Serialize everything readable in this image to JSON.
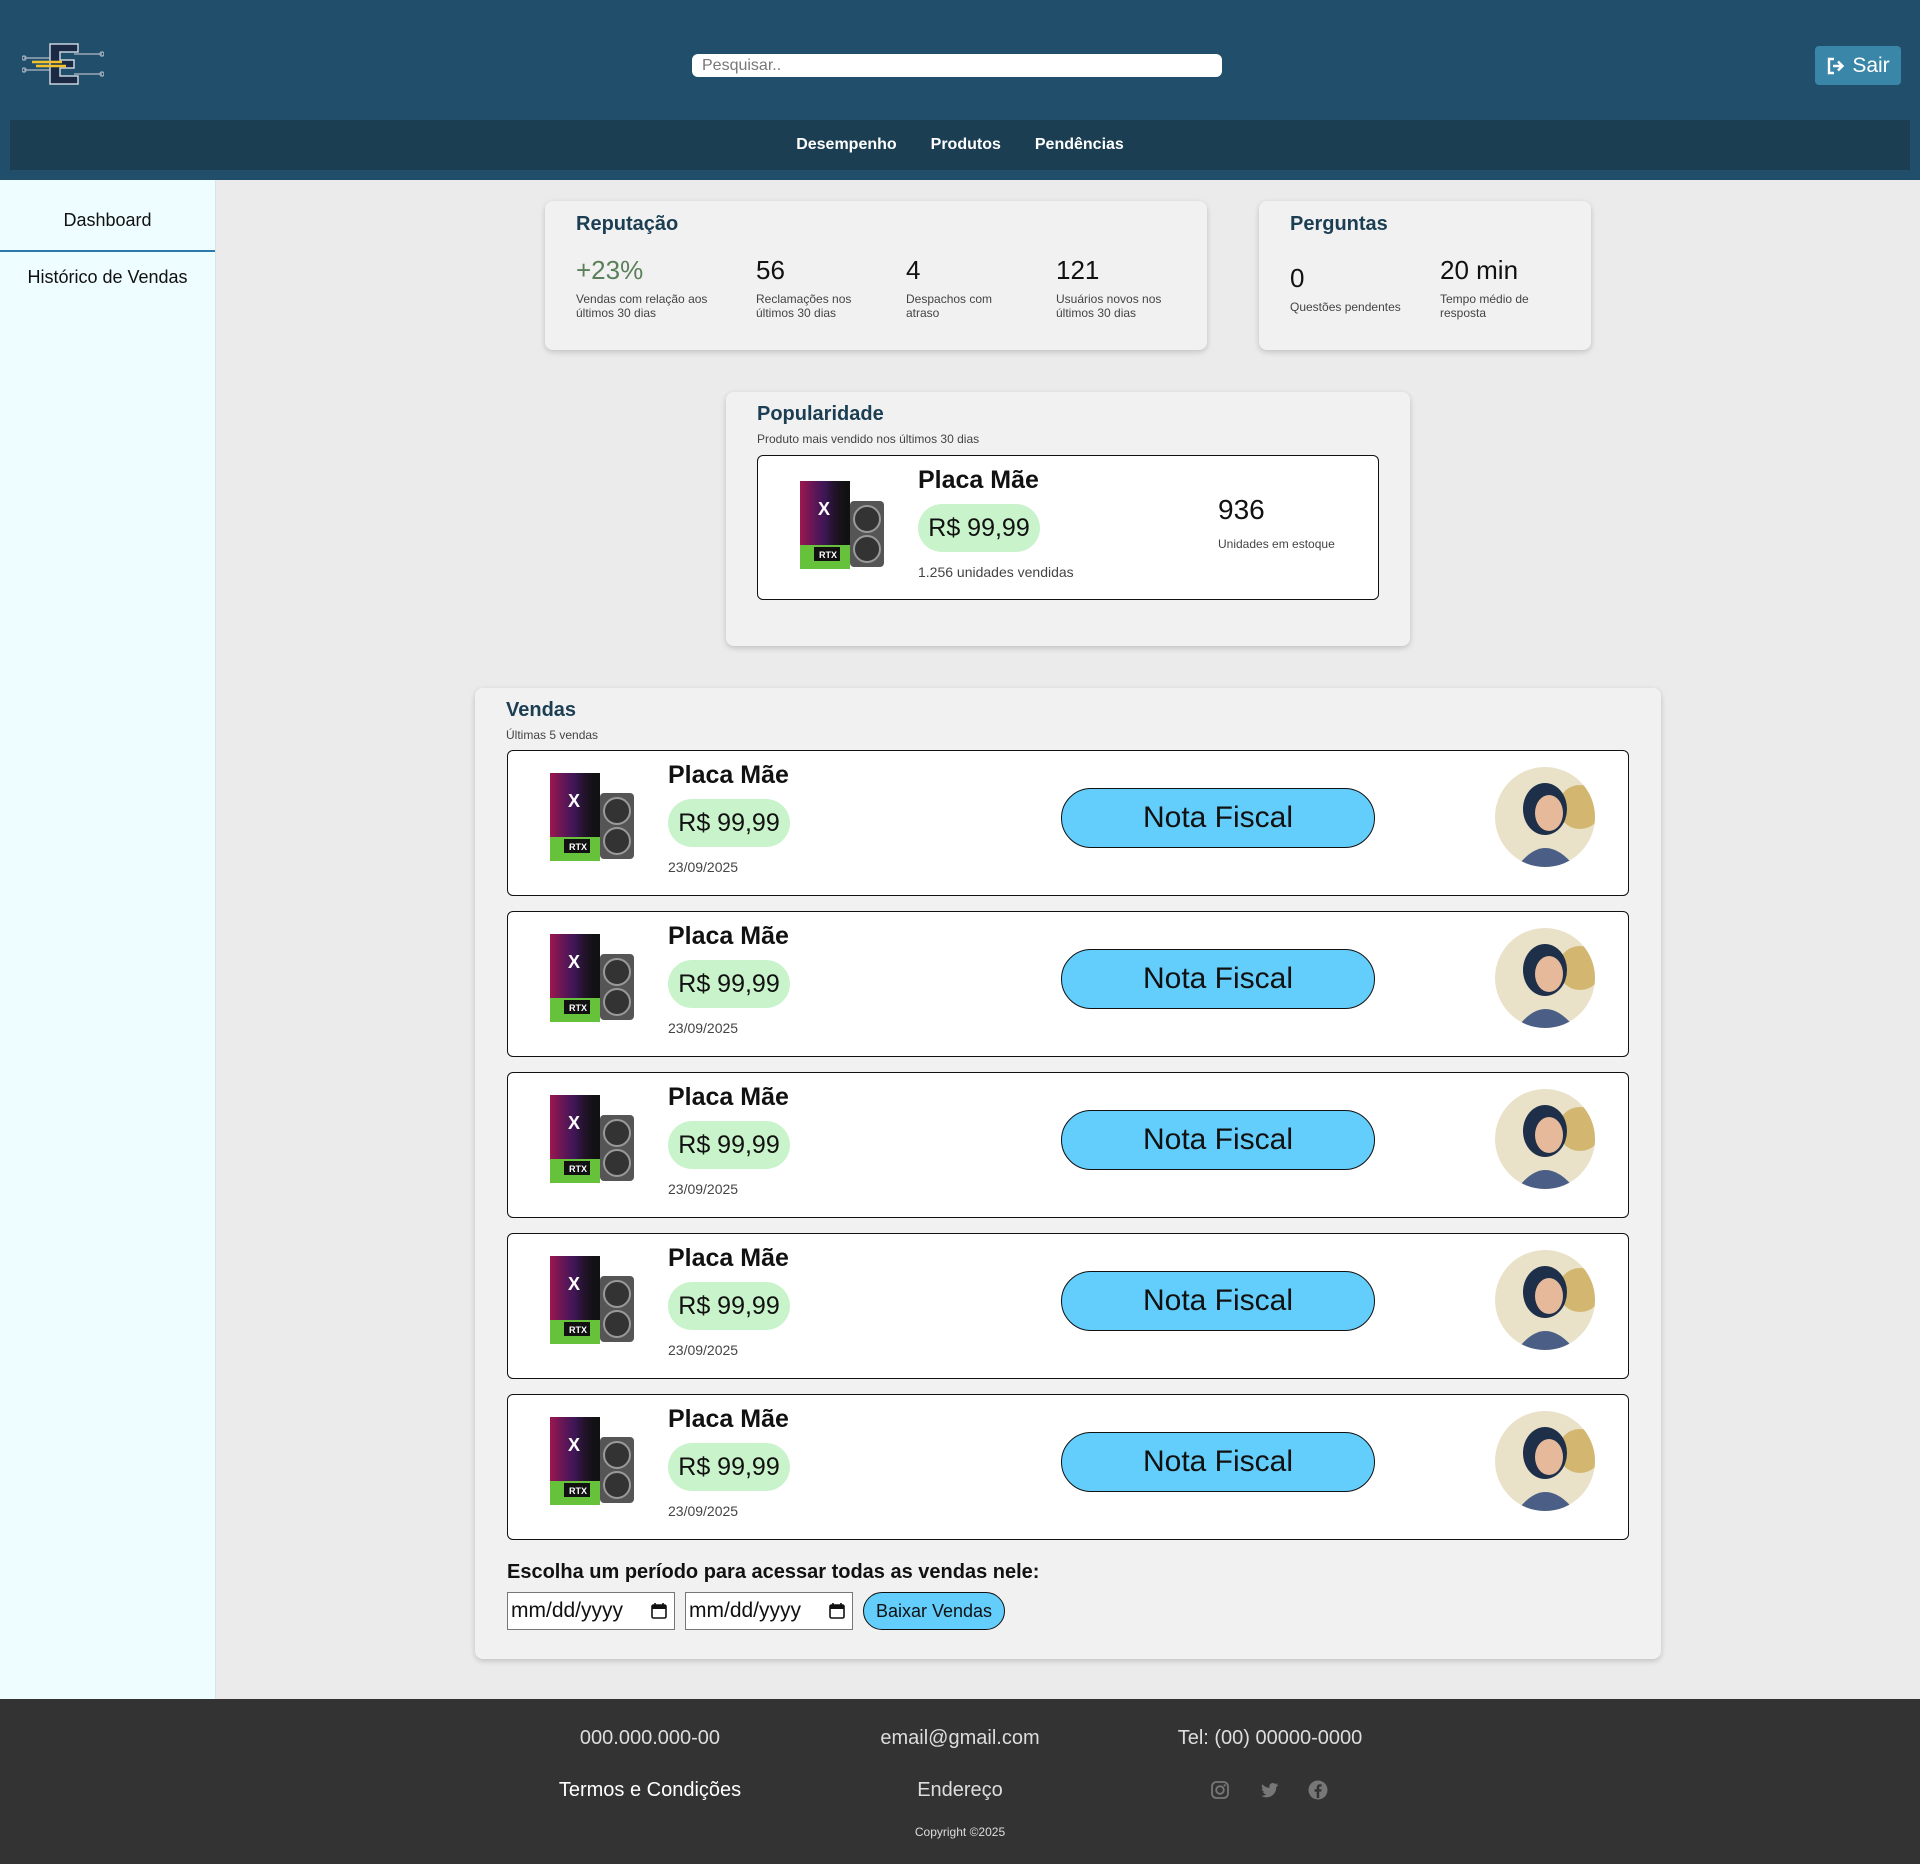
{
  "header": {
    "search_placeholder": "Pesquisar..",
    "logout_label": "Sair",
    "nav": [
      "Desempenho",
      "Produtos",
      "Pendências"
    ]
  },
  "sidebar": {
    "items": [
      "Dashboard",
      "Histórico de Vendas"
    ]
  },
  "reputation": {
    "title": "Reputação",
    "stats": [
      {
        "value": "+23%",
        "label": "Vendas com relação aos últimos 30 dias"
      },
      {
        "value": "56",
        "label": "Reclamações nos últimos 30 dias"
      },
      {
        "value": "4",
        "label": "Despachos com atraso"
      },
      {
        "value": "121",
        "label": "Usuários novos nos últimos 30 dias"
      }
    ]
  },
  "questions": {
    "title": "Perguntas",
    "stats": [
      {
        "value": "0",
        "label": "Questões pendentes"
      },
      {
        "value": "20 min",
        "label": "Tempo médio de resposta"
      }
    ]
  },
  "popularity": {
    "title": "Popularidade",
    "subtitle": "Produto mais vendido nos últimos 30 dias",
    "product": {
      "name": "Placa Mãe",
      "price": "R$ 99,99",
      "sold": "1.256 unidades vendidas",
      "stock_value": "936",
      "stock_label": "Unidades em estoque"
    }
  },
  "sales": {
    "title": "Vendas",
    "subtitle": "Últimas 5 vendas",
    "invoice_label": "Nota Fiscal",
    "rows": [
      {
        "name": "Placa Mãe",
        "price": "R$ 99,99",
        "date": "23/09/2025"
      },
      {
        "name": "Placa Mãe",
        "price": "R$ 99,99",
        "date": "23/09/2025"
      },
      {
        "name": "Placa Mãe",
        "price": "R$ 99,99",
        "date": "23/09/2025"
      },
      {
        "name": "Placa Mãe",
        "price": "R$ 99,99",
        "date": "23/09/2025"
      },
      {
        "name": "Placa Mãe",
        "price": "R$ 99,99",
        "date": "23/09/2025"
      }
    ],
    "period_label": "Escolha um período para acessar todas as vendas nele:",
    "date_placeholder": "mm/dd/yyyy",
    "download_label": "Baixar Vendas"
  },
  "footer": {
    "cnpj": "000.000.000-00",
    "email": "email@gmail.com",
    "phone": "Tel: (00) 00000-0000",
    "terms": "Termos e Condições",
    "address": "Endereço",
    "copyright": "Copyright ©2025"
  },
  "colors": {
    "header": "#214f6b",
    "nav": "#1b3e53",
    "accent": "#63cdfb",
    "price_pill": "#c9f3ca",
    "footer": "#333333"
  }
}
